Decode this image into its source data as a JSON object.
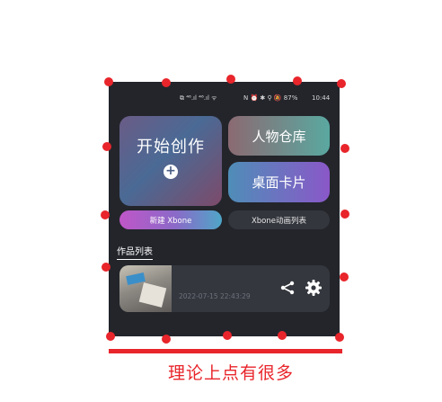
{
  "statusbar": {
    "left_icons": "⧉ ⁴⁶.ıl ⁴⁶.ıl ᯤ",
    "right_icons": "N ⏰ ✱ ⚲ 🔕 87%",
    "time": "10:44"
  },
  "cards": {
    "create_label": "开始创作",
    "create_icon": "+",
    "characters_label": "人物仓库",
    "desktop_cards_label": "桌面卡片"
  },
  "pills": {
    "new_xbone": "新建 Xbone",
    "xbone_anim_list": "Xbone动画列表"
  },
  "works": {
    "title": "作品列表",
    "items": [
      {
        "date": "2022-07-15 22:43:29"
      }
    ]
  },
  "annotation": {
    "caption": "理论上点有很多",
    "accent": "#e8252b"
  }
}
